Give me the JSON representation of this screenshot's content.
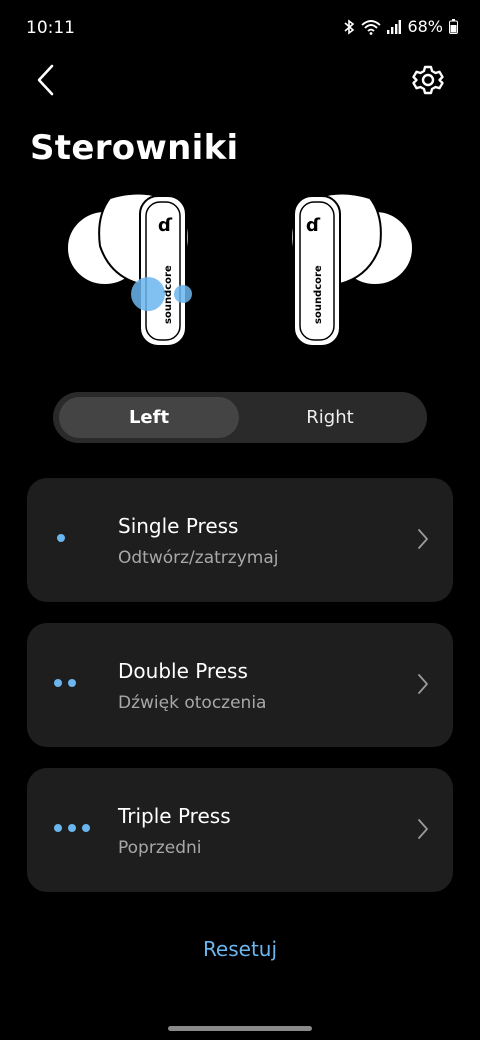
{
  "status": {
    "time": "10:11",
    "battery": "68%"
  },
  "header": {
    "title": "Sterowniki",
    "back_icon": "chevron-left-icon",
    "settings_icon": "gear-icon"
  },
  "earbuds": {
    "brand": "soundcore",
    "logo_letter": "ɗ"
  },
  "tabs": [
    {
      "label": "Left",
      "selected": true
    },
    {
      "label": "Right",
      "selected": false
    }
  ],
  "controls": [
    {
      "title": "Single Press",
      "action": "Odtwórz/zatrzymaj",
      "dots": 1
    },
    {
      "title": "Double Press",
      "action": "Dźwięk otoczenia",
      "dots": 2
    },
    {
      "title": "Triple Press",
      "action": "Poprzedni",
      "dots": 3
    }
  ],
  "reset_label": "Resetuj",
  "colors": {
    "accent": "#6bb6ee",
    "card_bg": "#1e1e1e",
    "background": "#000000"
  }
}
